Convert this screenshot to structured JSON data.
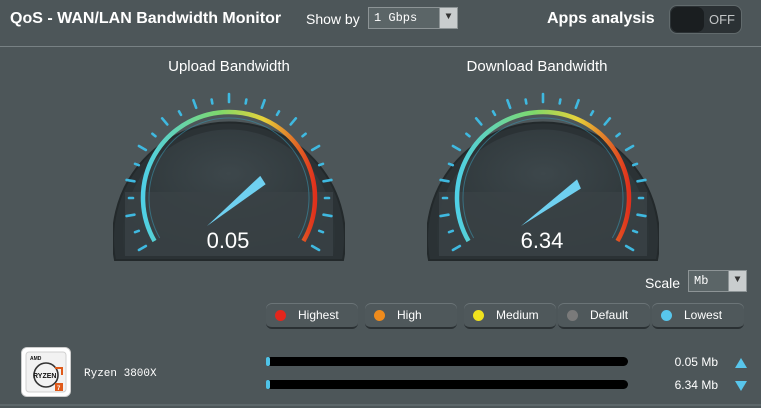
{
  "header": {
    "title": "QoS - WAN/LAN Bandwidth Monitor",
    "show_by_label": "Show by",
    "show_by_value": "1 Gbps",
    "apps_analysis_label": "Apps analysis",
    "apps_analysis_toggle": "OFF"
  },
  "gauges": {
    "upload": {
      "title": "Upload Bandwidth",
      "value": "0.05",
      "needle_fraction": 0.74
    },
    "download": {
      "title": "Download Bandwidth",
      "value": "6.34",
      "needle_fraction": 0.78
    }
  },
  "scale": {
    "label": "Scale",
    "value": "Mb"
  },
  "priorities": [
    {
      "label": "Highest",
      "color": "#e3261c"
    },
    {
      "label": "High",
      "color": "#ef8b1c"
    },
    {
      "label": "Medium",
      "color": "#f0e21e"
    },
    {
      "label": "Default",
      "color": "#7a7a7a"
    },
    {
      "label": "Lowest",
      "color": "#58c6ec"
    }
  ],
  "device": {
    "logo_brand": "AMD",
    "logo_text": "RYZEN",
    "logo_tier": "7",
    "name": "Ryzen 3800X"
  },
  "traffic": {
    "upload": {
      "rate": "0.05",
      "unit": "Mb",
      "icon": "upload-arrow-icon",
      "fill_fraction": 0.01
    },
    "download": {
      "rate": "6.34",
      "unit": "Mb",
      "icon": "download-arrow-icon",
      "fill_fraction": 0.01
    }
  },
  "colors": {
    "background": "#4d5659",
    "accent": "#4fc3e8"
  }
}
